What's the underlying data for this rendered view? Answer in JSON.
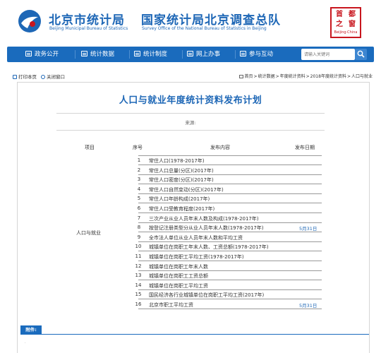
{
  "header": {
    "site_name": "北京市统计局",
    "site_name_en": "Beijing Municipal Bureau of Statistics",
    "survey_name": "国家统计局北京调查总队",
    "survey_name_en": "Survey Office of the National Bureau of Statistics in Beijing",
    "seal_chars": [
      "首",
      "都",
      "之",
      "窗"
    ],
    "seal_caption": "Beijing·China"
  },
  "nav": {
    "items": [
      {
        "label": "政务公开",
        "icon": "document-icon"
      },
      {
        "label": "统计数据",
        "icon": "chart-icon"
      },
      {
        "label": "统计制度",
        "icon": "table-icon"
      },
      {
        "label": "网上办事",
        "icon": "screen-icon"
      },
      {
        "label": "参与互动",
        "icon": "people-icon"
      }
    ],
    "search_placeholder": "请输入关键词"
  },
  "toolbar": {
    "print_label": "打印本页",
    "close_label": "关闭窗口",
    "breadcrumb": [
      "首页",
      "统计数据",
      "年度统计资料",
      "2018年度统计资料",
      "人口与就业"
    ]
  },
  "article": {
    "title": "人口与就业年度统计资料发布计划",
    "source_label": "来源:"
  },
  "table": {
    "headers": {
      "item": "项目",
      "seq": "序号",
      "content": "发布内容",
      "date": "发布日期"
    },
    "category": "人口与就业",
    "rows": [
      {
        "no": "1",
        "content": "常住人口(1978-2017年)",
        "date": ""
      },
      {
        "no": "2",
        "content": "常住人口总量(分区)(2017年)",
        "date": ""
      },
      {
        "no": "3",
        "content": "常住人口密度(分区)(2017年)",
        "date": ""
      },
      {
        "no": "4",
        "content": "常住人口自然变动(分区)(2017年)",
        "date": ""
      },
      {
        "no": "5",
        "content": "常住人口年龄构成(2017年)",
        "date": ""
      },
      {
        "no": "6",
        "content": "常住人口受教育程度(2017年)",
        "date": ""
      },
      {
        "no": "7",
        "content": "三次产业从业人员年末人数及构成(1978-2017年)",
        "date": ""
      },
      {
        "no": "8",
        "content": "按登记注册类型分从业人员年末人数(1978-2017年)",
        "date": "5月31日"
      },
      {
        "no": "9",
        "content": "全市法人单位从业人员年末人数和平均工资",
        "date": ""
      },
      {
        "no": "10",
        "content": "城镇单位在岗职工年末人数、工资总额(1978-2017年)",
        "date": ""
      },
      {
        "no": "11",
        "content": "城镇单位在岗职工平均工资(1978-2017年)",
        "date": ""
      },
      {
        "no": "12",
        "content": "城镇单位在岗职工年末人数",
        "date": ""
      },
      {
        "no": "13",
        "content": "城镇单位在岗职工工资总额",
        "date": ""
      },
      {
        "no": "14",
        "content": "城镇单位在岗职工平均工资",
        "date": ""
      },
      {
        "no": "15",
        "content": "国民经济各行业城镇单位在岗职工平均工资(2017年)",
        "date": ""
      },
      {
        "no": "16",
        "content": "北京市职工平均工资",
        "date": "5月31日"
      }
    ]
  },
  "attachment": {
    "label": "附件:",
    "marker": "."
  },
  "colors": {
    "brand_blue": "#1e67b6",
    "nav_blue": "#1a6bbd",
    "seal_red": "#c8161e"
  }
}
